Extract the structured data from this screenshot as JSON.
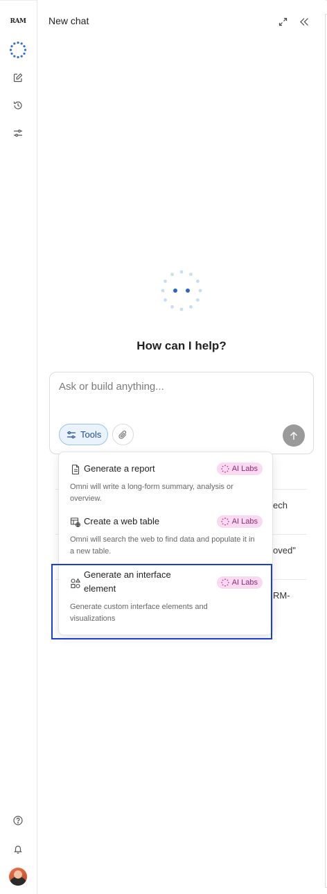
{
  "rail": {
    "logo_text": "RAM",
    "items": [
      {
        "name": "omni-logo-icon"
      },
      {
        "name": "new-chat-icon"
      },
      {
        "name": "history-icon"
      },
      {
        "name": "settings-sliders-icon"
      }
    ],
    "bottom": [
      {
        "name": "help-icon"
      },
      {
        "name": "notifications-bell-icon"
      }
    ]
  },
  "header": {
    "title": "New chat"
  },
  "main": {
    "greeting": "How can I help?",
    "composer": {
      "placeholder": "Ask or build anything...",
      "tools_label": "Tools"
    }
  },
  "background_fragments": [
    "ech",
    "oved\"",
    "RM-"
  ],
  "tools_menu": {
    "items": [
      {
        "title": "Generate a report",
        "badge": "AI Labs",
        "description": "Omni will write a long-form summary, analysis or overview."
      },
      {
        "title": "Create a web table",
        "badge": "AI Labs",
        "description": "Omni will search the web to find data and populate it in a new table."
      },
      {
        "title": "Generate an interface element",
        "badge": "AI Labs",
        "description": "Generate custom interface elements and visualizations"
      }
    ]
  },
  "colors": {
    "accent_blue": "#1d4f91",
    "badge_bg": "#fbd9f1",
    "badge_text": "#8a2a73",
    "highlight": "#1a3fd6"
  }
}
